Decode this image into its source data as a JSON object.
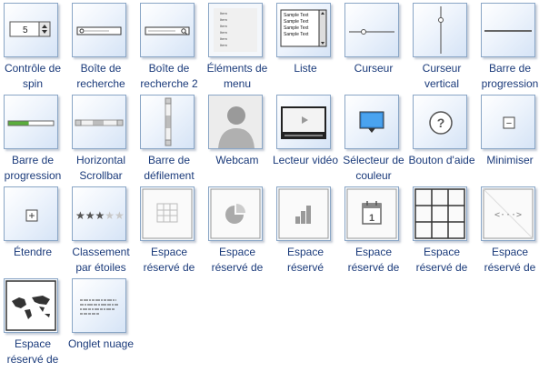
{
  "items": [
    {
      "label": "Contrôle de spin",
      "icon": "spin-control-icon",
      "spin_value": "5"
    },
    {
      "label": "Boîte de recherche",
      "icon": "search-box-icon"
    },
    {
      "label": "Boîte de recherche 2",
      "icon": "search-box-2-icon"
    },
    {
      "label": "Éléments de menu",
      "icon": "menu-items-icon",
      "menu_lines": [
        "Item",
        "Item",
        "Item",
        "Item",
        "Item",
        "Item"
      ]
    },
    {
      "label": "Liste",
      "icon": "list-icon",
      "list_lines": [
        "Sample Text",
        "Sample Text",
        "Sample Text",
        "Sample Text"
      ]
    },
    {
      "label": "Curseur",
      "icon": "slider-icon"
    },
    {
      "label": "Curseur vertical",
      "icon": "vertical-slider-icon"
    },
    {
      "label": "Barre de progression",
      "icon": "progress-bar-icon"
    },
    {
      "label": "Barre de progression",
      "icon": "progress-bar-green-icon",
      "progress": 0.45
    },
    {
      "label": "Horizontal Scrollbar",
      "icon": "horizontal-scrollbar-icon"
    },
    {
      "label": "Barre de défilement",
      "icon": "vertical-scrollbar-icon"
    },
    {
      "label": "Webcam",
      "icon": "webcam-icon"
    },
    {
      "label": "Lecteur vidéo",
      "icon": "video-player-icon"
    },
    {
      "label": "Sélecteur de couleur",
      "icon": "color-picker-icon"
    },
    {
      "label": "Bouton d'aide",
      "icon": "help-button-icon",
      "glyph": "?"
    },
    {
      "label": "Minimiser",
      "icon": "minimize-icon",
      "glyph": "−"
    },
    {
      "label": "Étendre",
      "icon": "expand-icon",
      "glyph": "+"
    },
    {
      "label": "Classement par étoiles",
      "icon": "star-rating-icon",
      "stars": "★★★★★",
      "rating": 3
    },
    {
      "label": "Espace réservé de",
      "icon": "table-placeholder-icon"
    },
    {
      "label": "Espace réservé de",
      "icon": "chart-placeholder-icon"
    },
    {
      "label": "Espace réservé",
      "icon": "bar-chart-placeholder-icon"
    },
    {
      "label": "Espace réservé de",
      "icon": "calendar-placeholder-icon",
      "calendar_number": "1"
    },
    {
      "label": "Espace réservé de",
      "icon": "grid-placeholder-icon"
    },
    {
      "label": "Espace réservé de",
      "icon": "code-placeholder-icon",
      "code_glyph": "<···>"
    },
    {
      "label": "Espace réservé de",
      "icon": "map-placeholder-icon"
    },
    {
      "label": "Onglet nuage",
      "icon": "tag-cloud-icon"
    }
  ]
}
